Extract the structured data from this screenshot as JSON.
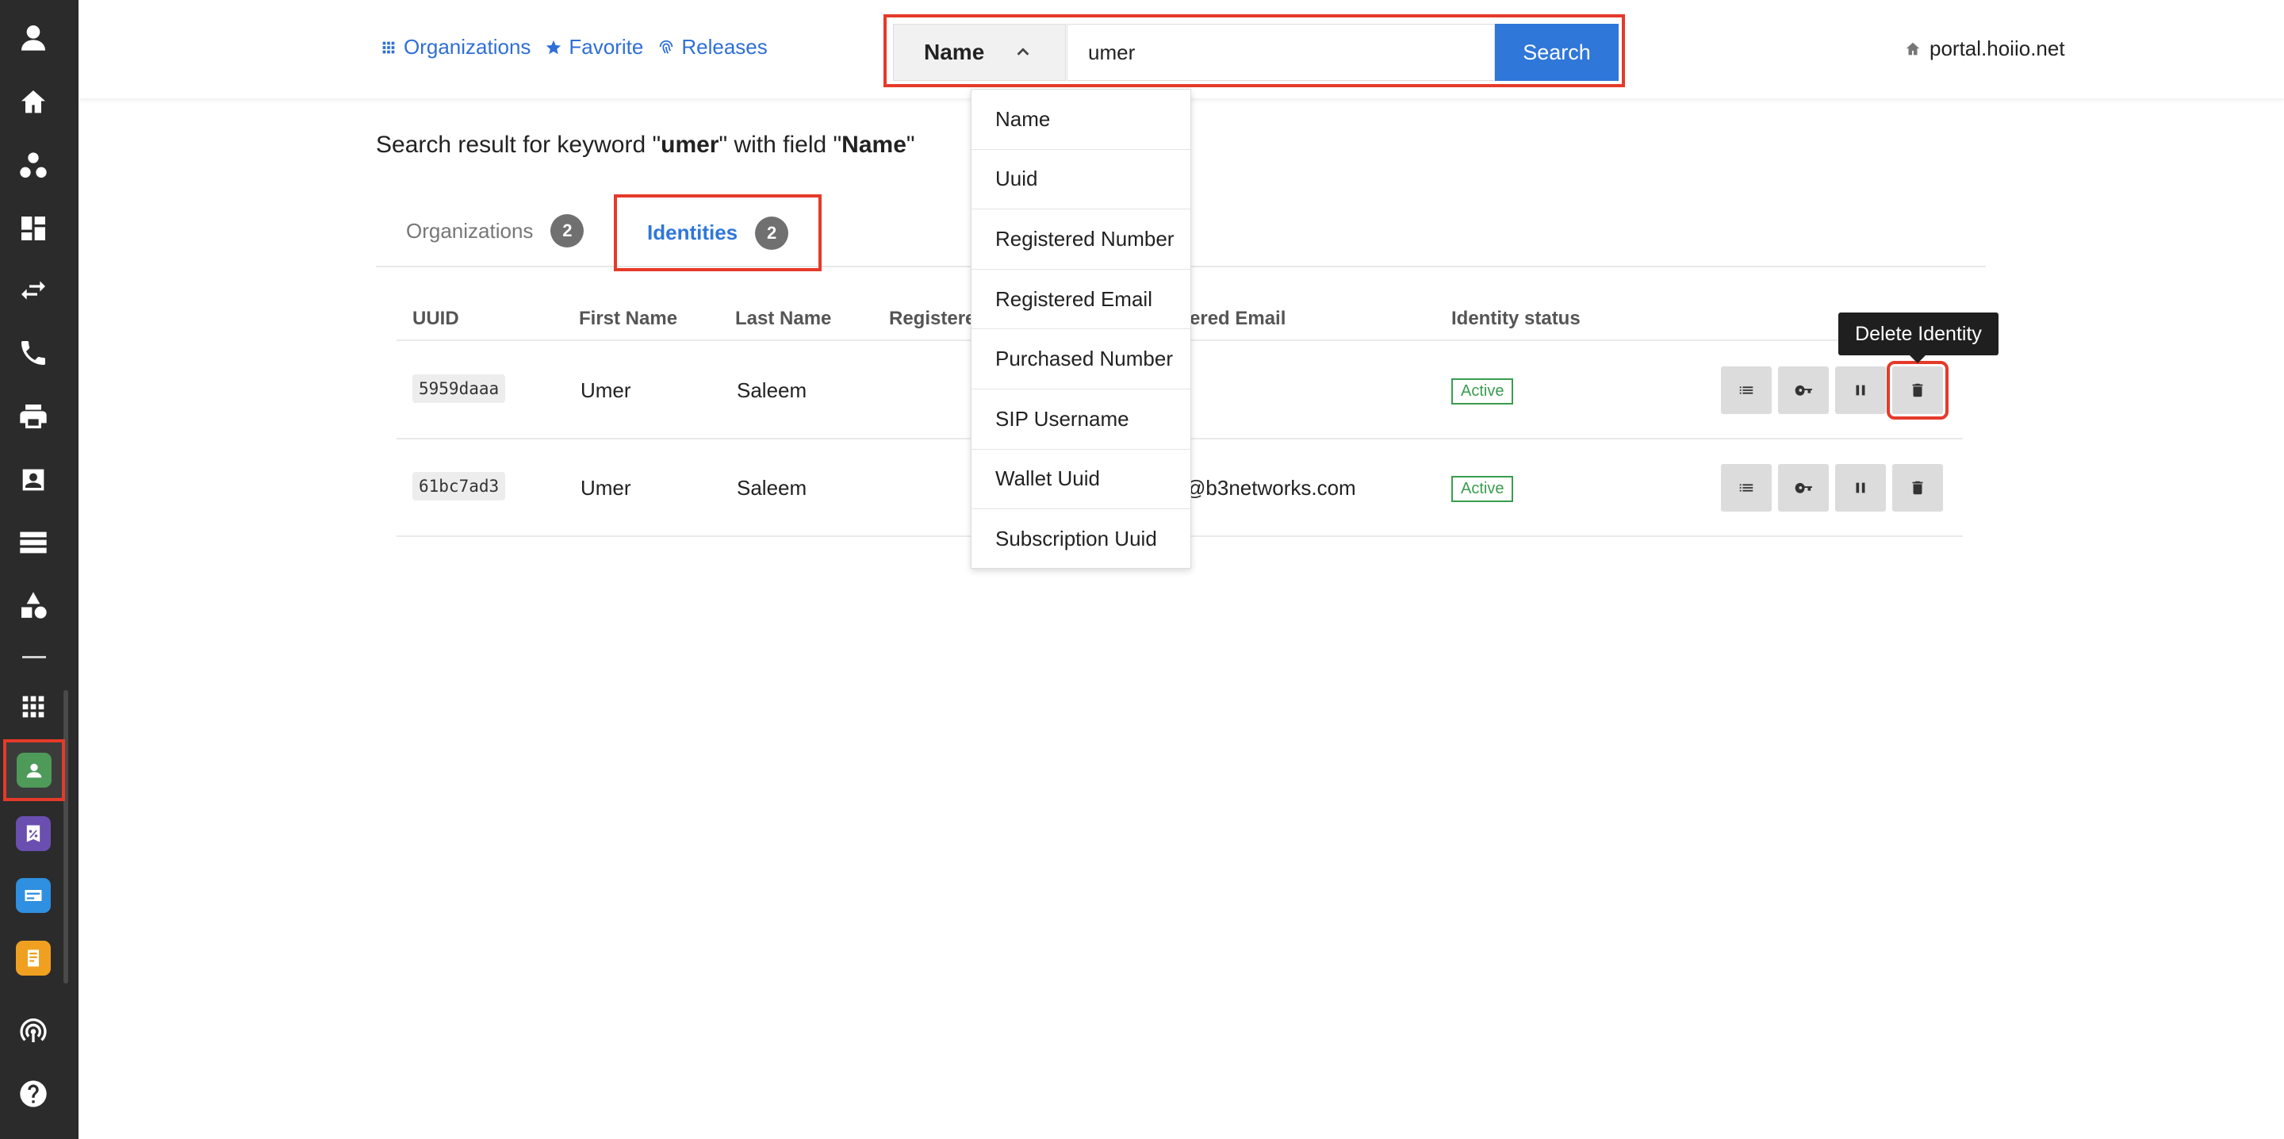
{
  "rail": {
    "icons": [
      "user-avatar-icon",
      "home-icon",
      "groups-icon",
      "dashboard-icon",
      "swap-icon",
      "phone-icon",
      "printer-icon",
      "contact-card-icon",
      "storage-icon",
      "shapes-icon",
      "apps-grid-icon",
      "identity-app-icon",
      "discount-app-icon",
      "card-app-icon",
      "notes-app-icon",
      "broadcast-icon",
      "help-icon"
    ],
    "colors": {
      "identity_app": "#4e9a59",
      "discount_app": "#6a4fb0",
      "card_app": "#2f8fe0",
      "notes_app": "#f0a020"
    }
  },
  "topbar": {
    "links": [
      {
        "label": "Organizations",
        "icon": "grid-icon"
      },
      {
        "label": "Favorite",
        "icon": "star-icon"
      },
      {
        "label": "Releases",
        "icon": "fingerprint-icon"
      }
    ],
    "search": {
      "field_label": "Name",
      "value": "umer",
      "button_label": "Search"
    },
    "portal": "portal.hoiio.net"
  },
  "dropdown": {
    "options": [
      "Name",
      "Uuid",
      "Registered Number",
      "Registered Email",
      "Purchased Number",
      "SIP Username",
      "Wallet Uuid",
      "Subscription Uuid"
    ]
  },
  "result": {
    "prefix": "Search result for keyword \"",
    "keyword": "umer",
    "middle": "\" with field \"",
    "field": "Name",
    "suffix": "\""
  },
  "tabs": [
    {
      "label": "Organizations",
      "count": "2"
    },
    {
      "label": "Identities",
      "count": "2"
    }
  ],
  "table": {
    "headers": [
      "UUID",
      "First Name",
      "Last Name",
      "Registere",
      "ered Email",
      "Identity status"
    ],
    "rows": [
      {
        "uuid": "5959daaa",
        "first": "Umer",
        "last": "Saleem",
        "email": "",
        "status": "Active"
      },
      {
        "uuid": "61bc7ad3",
        "first": "Umer",
        "last": "Saleem",
        "email": "@b3networks.com",
        "status": "Active"
      }
    ]
  },
  "tooltip": "Delete Identity",
  "accent": "#2f77d9",
  "highlight": "#e53a2a"
}
